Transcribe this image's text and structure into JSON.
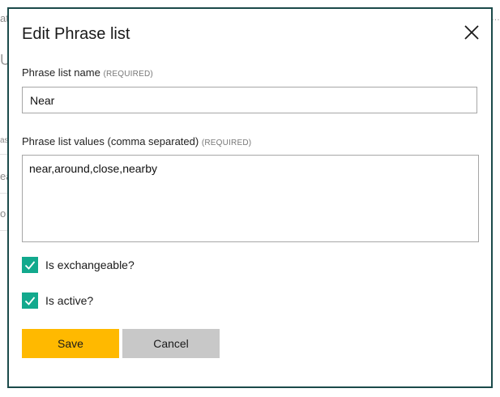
{
  "background": {
    "fragments": [
      "at",
      "U",
      "as",
      "ea",
      "o"
    ]
  },
  "dialog": {
    "title": "Edit Phrase list",
    "name_field": {
      "label": "Phrase list name",
      "required_tag": "(REQUIRED)",
      "value": "Near"
    },
    "values_field": {
      "label": "Phrase list values (comma separated)",
      "required_tag": "(REQUIRED)",
      "value": "near,around,close,nearby"
    },
    "checkboxes": [
      {
        "label": "Is exchangeable?",
        "checked": true
      },
      {
        "label": "Is active?",
        "checked": true
      }
    ],
    "buttons": {
      "save": "Save",
      "cancel": "Cancel"
    }
  },
  "colors": {
    "dialog_border": "#1b4a4a",
    "checkbox": "#12a98d",
    "save_button": "#ffb900",
    "cancel_button": "#c8c8c8"
  },
  "icons": {
    "close": "close-icon",
    "check": "checkmark-icon"
  }
}
